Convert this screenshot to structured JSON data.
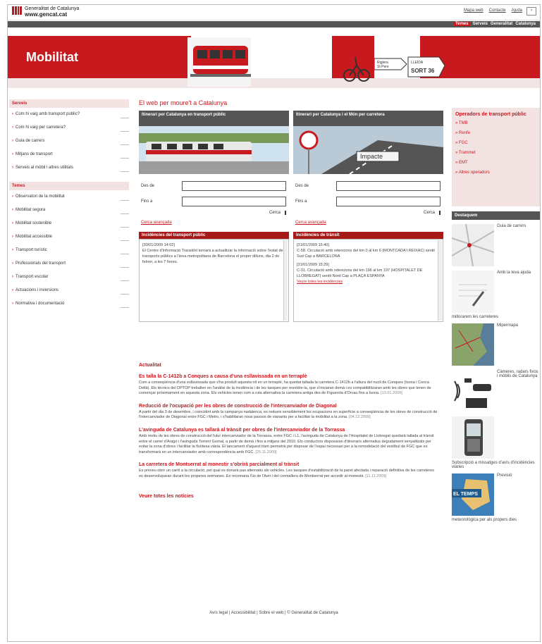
{
  "header": {
    "brand_line1": "Generalitat de Catalunya",
    "brand_line2": "www.gencat.cat",
    "links": [
      "Mapa web",
      "Contacte",
      "Ajuda"
    ],
    "nav": [
      "Temes",
      "Serveis",
      "Generalitat",
      "Catalunya"
    ]
  },
  "banner": {
    "title": "Mobilitat",
    "sign1a": "Riglera",
    "sign1b": "St Pere",
    "sign1c": "Alella",
    "sign2a": "LLEIDA",
    "sign2b": "SORT 36"
  },
  "sidebar": {
    "serveis_title": "Serveis",
    "serveis": [
      "Com hi vaig amb transport públic?",
      "Com hi vaig per carretera?",
      "Guia de carrers",
      "Mitjans de transport",
      "Serveis al mòbil i altres utilitats"
    ],
    "temes_title": "Temes",
    "temes": [
      "Observatori de la mobilitat",
      "Mobilitat segura",
      "Mobilitat sostenible",
      "Mobilitat accessible",
      "Transport turístic",
      "Professionals del transport",
      "Transport escolar",
      "Actuacions i inversions",
      "Normativa i documentació"
    ]
  },
  "main": {
    "title": "El web per moure't a Catalunya",
    "panel_public": {
      "head": "Itinerari per Catalunya en transport públic",
      "from": "Des de",
      "to": "Fins a",
      "search": "Cerca",
      "advanced": "Cerca avançada"
    },
    "panel_road": {
      "head": "Itinerari per Catalunya i el Món per carretera",
      "overlay": "Impacte",
      "from": "Des de",
      "to": "Fins a",
      "search": "Cerca",
      "advanced": "Cerca avançada"
    },
    "inc_public": {
      "head": "Incidències del transport públic",
      "date": "[30/01/2009 14:02]",
      "text": "El Centre d'Informació Transit/el tornarà a actualitzar la informació sobre l'estat des transports públics a l'àrea metropolitana de Barcelona el proper dilluns, dia 2 de febrer, a les 7 hores."
    },
    "inc_road": {
      "head": "Incidències de trànsit",
      "date1": "[31/01/2009 15:40]",
      "text1": "C-58. Circulació amb retencions del km 0 al km 6 (MONTCADA I REIXAC) sentit Sud Cap a BARCELONA",
      "date2": "[31/01/2009 15:29]",
      "text2": "C-31. Circulació amb retencions del km 196 al km 197 (HOSPITALET DE LLOBREGAT) sentit Nord Cap a PLAÇA ESPANYA",
      "more": "Veure totes les incidències"
    }
  },
  "news": {
    "title": "Actualitat",
    "items": [
      {
        "h": "Es talla la C-1412b a Conques a causa d'una esllavissada en un terraplè",
        "b": "Com a conseqüència d'una esllavissada que s'ha produït aquesta nit en un terraplè, ha quedat tallada la carretera C-1412b a l'altura del nucli de Conques (Isona i Conca Dellà). Els tècnics del DPTOP treballen en l'anàlisi de la incidència i de les tasques per resoldre-la, que s'iniciaran demà i es compatibilitzaran amb les obres que tenen de començar pròximament en aquesta zona. Els vehicles tenen com a ruta alternativa la carretera antiga des de Figuerola d'Orcau fins a Isona.",
        "d": "[13.01.2009]"
      },
      {
        "h": "Reducció de l'ocupació per les obres de construcció de l'intercanviador de Diagonal",
        "b": "A partir del dia 3 de desembre, i coincidint amb la campanya nadalenca, es redueix sensiblement les ocupacions en superfície a conseqüència de les obres de construcció de l'intercanviador de Diagonal entre FGC i Metro, i s'habilitaran nous passos de vianants per a facilitar la mobilitat a la zona.",
        "d": "[04.12.2009]"
      },
      {
        "h": "L'avinguda de Catalunya es tallarà al trànsit per obres de l'intercanviador de la Torrassa",
        "b": "Amb motiu de les obres de construcció del futur intercanviador de la Torrassa, entre FGC i L1, l'avinguda de Catalunya de l'Hospitalet de Llobregat quedarà tallada al trànsit entre el carrer d'Aragó i l'avinguda Torrent Gornal, a partir de demà i fins a mitjans del 2010. Els conductors disposaran d'itineraris alternatius degudament senyalitzats per evitar la zona d'obres i facilitar la fluïdesa viària. El tancament d'aquest tram permetrà per disposar de l'espai necessari per a la remodelació del vestíbul de FGC que es transformarà en un intercanviador amb correspondència amb FGC.",
        "d": "[25.11.2009]"
      },
      {
        "h": "La carretera de Montserrat al monestir s'obrirà parcialment al trànsit",
        "b": "Es preveu obrir un carril a la circulació, pel qual es donarà pas alternatiu als vehicles. Les tasques d'estabilització de la paret afectada i reparació definitiva de les carreteres es desenvoluparan durant les properes setmanes. Es recomana l'ús de l'Aeri i del cremallera de Montserrat per accedir al monestir.",
        "d": "[11.11.2009]"
      }
    ],
    "all": "Veure totes les notícies"
  },
  "right": {
    "ops_title": "Operadors de transport públic",
    "ops": [
      "TMB",
      "Renfe",
      "FGC",
      "Trammet",
      "EMT",
      "Altres operadors"
    ],
    "dest_title": "Destaquem",
    "dest": [
      {
        "label": "Guia de carrers",
        "extra": ""
      },
      {
        "label": "Amb la teva ajuda",
        "extra": "millorarem les carreteres"
      },
      {
        "label": "Mipermapa",
        "extra": ""
      },
      {
        "label": "Càmeres, radars fixos i mòbils de Catalunya",
        "extra": ""
      },
      {
        "label": "",
        "extra": "Subscripció a missatges d'avís d'incidències viàries"
      },
      {
        "label": "Previsió",
        "extra": "meteorològica per als propers dies"
      }
    ],
    "meteo_badge": "EL TEMPS"
  },
  "footer": {
    "text": "Avís legal | Accessibilitat | Sobre el web | © Generalitat de Catalunya"
  }
}
